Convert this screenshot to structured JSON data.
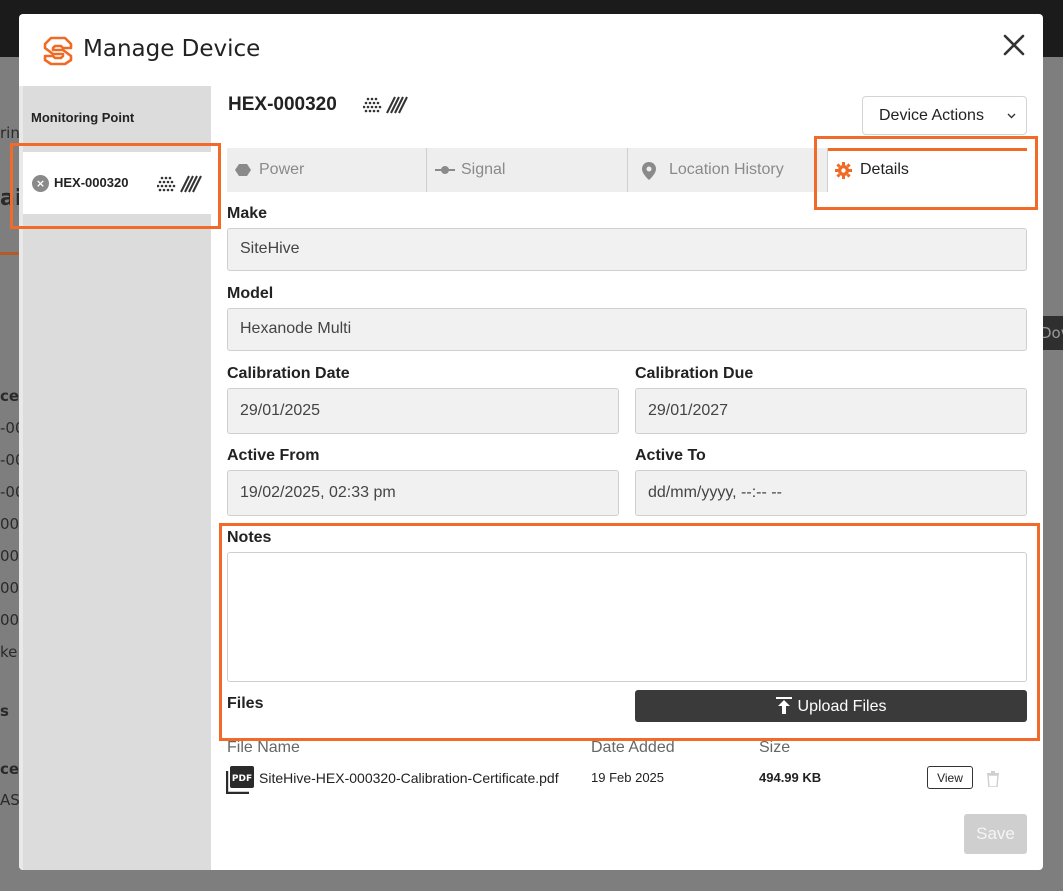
{
  "background": {
    "fragments": [
      "rin",
      "ai",
      "ce",
      "-00",
      "-00",
      "-00",
      "00",
      "00",
      "00",
      "00",
      "ke",
      "s",
      "ce",
      "AS",
      "Dov"
    ]
  },
  "modal": {
    "title": "Manage Device",
    "close_icon": "close-icon",
    "logo_icon": "sitehive-logo-icon"
  },
  "sidebar": {
    "heading": "Monitoring Point",
    "items": [
      {
        "label": "HEX-000320",
        "remove_icon": "remove-circle-icon"
      }
    ]
  },
  "device": {
    "id": "HEX-000320",
    "actions_label": "Device Actions"
  },
  "tabs": [
    {
      "label": "Power",
      "icon": "hexagon-icon"
    },
    {
      "label": "Signal",
      "icon": "signal-icon"
    },
    {
      "label": "Location History",
      "icon": "location-pin-icon"
    },
    {
      "label": "Details",
      "icon": "gear-icon",
      "active": true
    }
  ],
  "details": {
    "make_label": "Make",
    "make_value": "SiteHive",
    "model_label": "Model",
    "model_value": "Hexanode Multi",
    "calibration_date_label": "Calibration Date",
    "calibration_date_value": "29/01/2025",
    "calibration_due_label": "Calibration Due",
    "calibration_due_value": "29/01/2027",
    "active_from_label": "Active From",
    "active_from_value": "19/02/2025, 02:33 pm",
    "active_to_label": "Active To",
    "active_to_placeholder": "dd/mm/yyyy, --:-- --",
    "notes_label": "Notes",
    "notes_value": "",
    "files_label": "Files",
    "upload_label": "Upload Files"
  },
  "files_table": {
    "headers": {
      "name": "File Name",
      "date": "Date Added",
      "size": "Size"
    },
    "rows": [
      {
        "name": "SiteHive-HEX-000320-Calibration-Certificate.pdf",
        "date": "19 Feb 2025",
        "size": "494.99 KB",
        "view_label": "View"
      }
    ]
  },
  "footer": {
    "save_label": "Save"
  },
  "colors": {
    "accent": "#f06a24",
    "highlight": "#f26a2a",
    "dark_button": "#3a3a3a"
  }
}
